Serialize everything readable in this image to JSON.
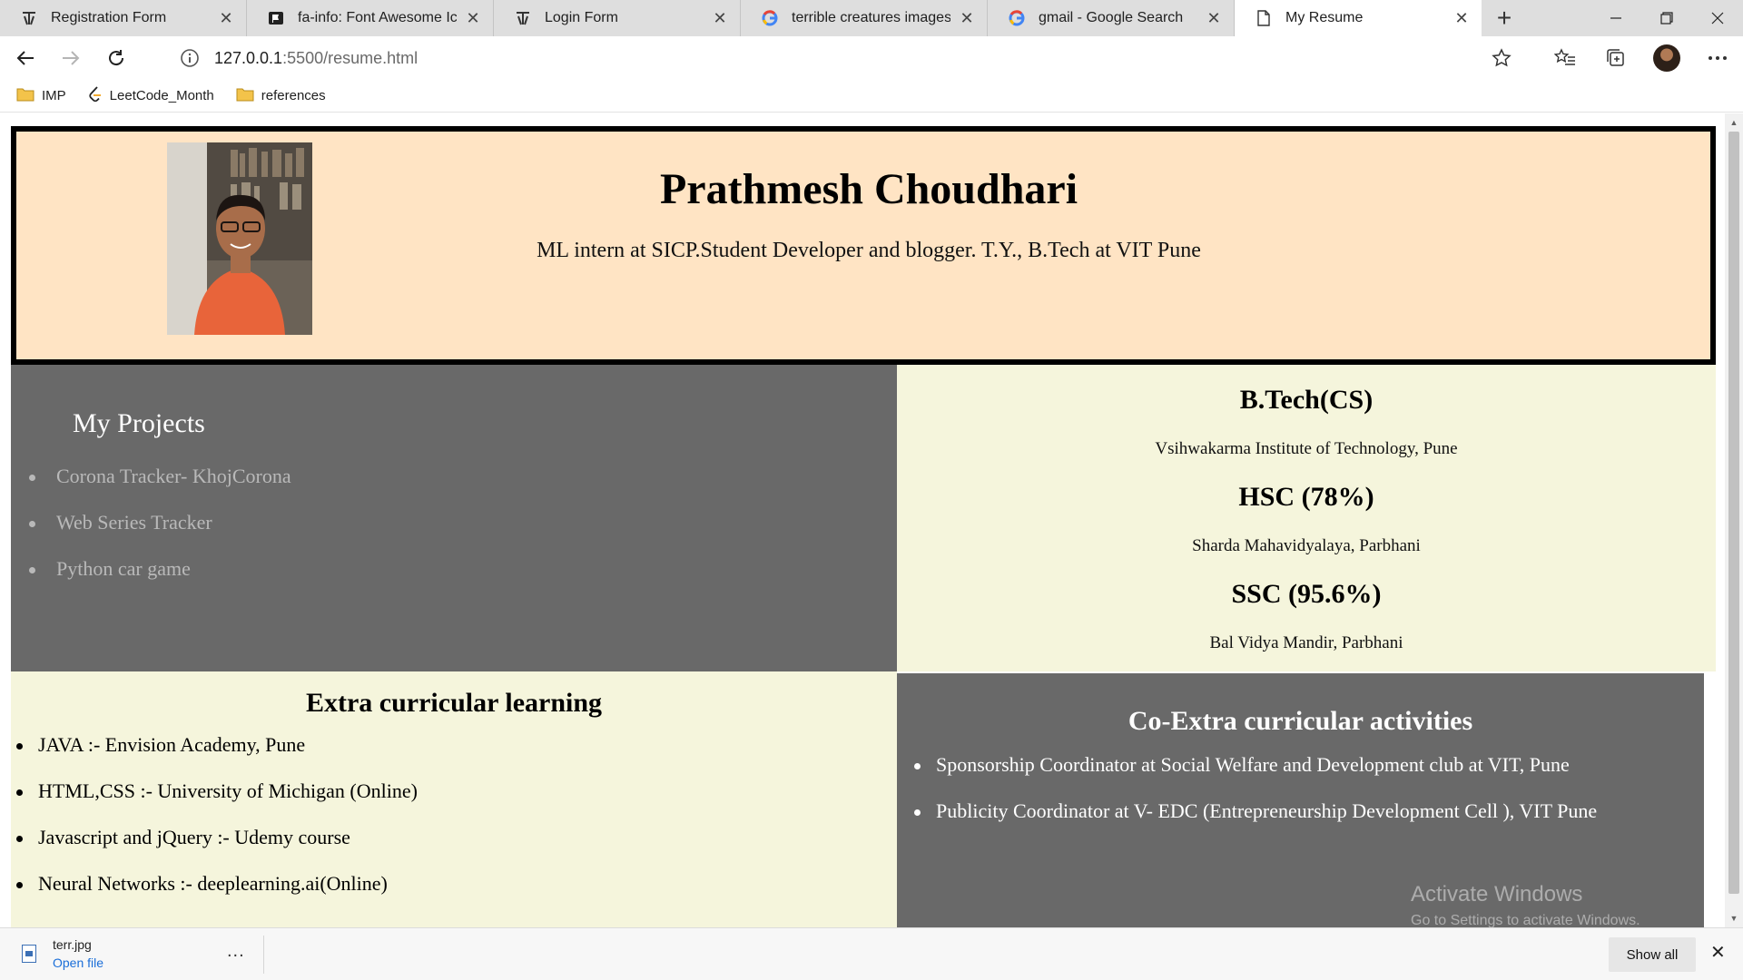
{
  "browser": {
    "tabs": [
      {
        "label": "Registration Form",
        "icon": "hackerrank-tab-icon",
        "active": false
      },
      {
        "label": "fa-info: Font Awesome Icons",
        "icon": "font-awesome-tab-icon",
        "active": false
      },
      {
        "label": "Login Form",
        "icon": "hackerrank-tab-icon",
        "active": false
      },
      {
        "label": "terrible creatures images - G",
        "icon": "google-tab-icon",
        "active": false
      },
      {
        "label": "gmail - Google Search",
        "icon": "google-tab-icon",
        "active": false
      },
      {
        "label": "My Resume",
        "icon": "page-tab-icon",
        "active": true
      }
    ],
    "new_tab_label": "+",
    "url": {
      "host": "127.0.0.1",
      "path": ":5500/resume.html"
    },
    "bookmarks": [
      {
        "label": "IMP",
        "icon": "folder-icon"
      },
      {
        "label": "LeetCode_Month",
        "icon": "leetcode-icon"
      },
      {
        "label": "references",
        "icon": "folder-icon"
      }
    ]
  },
  "resume": {
    "name": "Prathmesh Choudhari",
    "tagline": "ML intern at SICP.Student Developer and blogger. T.Y., B.Tech at VIT Pune",
    "projects": {
      "title": "My Projects",
      "items": [
        "Corona Tracker- KhojCorona",
        "Web Series Tracker",
        "Python car game"
      ]
    },
    "education": [
      {
        "degree": "B.Tech(CS)",
        "institution": "Vsihwakarma Institute of Technology, Pune"
      },
      {
        "degree": "HSC (78%)",
        "institution": "Sharda Mahavidyalaya, Parbhani"
      },
      {
        "degree": "SSC (95.6%)",
        "institution": "Bal Vidya Mandir, Parbhani"
      }
    ],
    "extra": {
      "title": "Extra curricular learning",
      "items": [
        "JAVA :- Envision Academy, Pune",
        "HTML,CSS :- University of Michigan (Online)",
        "Javascript and jQuery :- Udemy course",
        "Neural Networks :- deeplearning.ai(Online)"
      ]
    },
    "coextra": {
      "title": "Co-Extra curricular activities",
      "items": [
        "Sponsorship Coordinator at Social Welfare and Development club at VIT, Pune",
        "Publicity Coordinator at V- EDC (Entrepreneurship Development Cell ), VIT Pune"
      ]
    }
  },
  "watermark": {
    "line1": "Activate Windows",
    "line2": "Go to Settings to activate Windows."
  },
  "downloads": {
    "file_name": "terr.jpg",
    "open_label": "Open file",
    "more_label": "...",
    "show_all_label": "Show all"
  },
  "colors": {
    "header_bg": "#ffe4c4",
    "section_dark": "#696969",
    "section_light": "#f5f5dc"
  }
}
